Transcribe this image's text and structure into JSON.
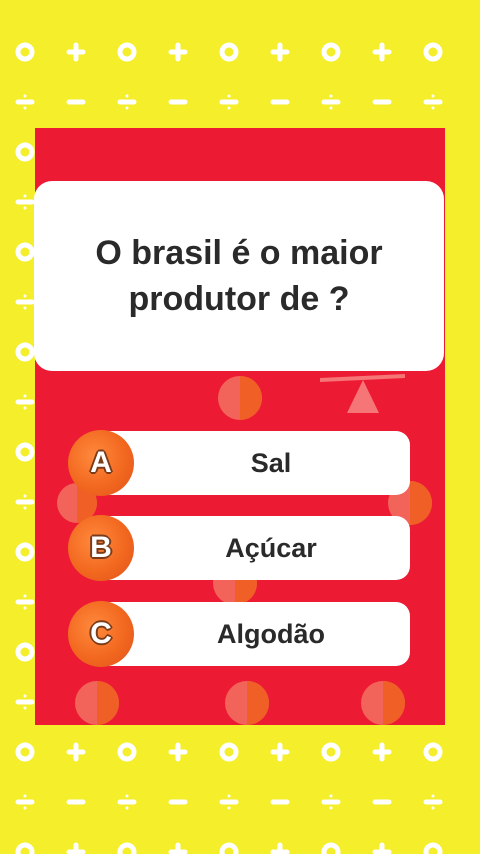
{
  "colors": {
    "background": "#f5ee2a",
    "panel": "#ec1a33",
    "card": "#ffffff",
    "badge": "#f2681f",
    "text": "#2a2a2a"
  },
  "question": {
    "line1": "O brasil é o maior",
    "line2": "produtor de ?"
  },
  "answers": [
    {
      "letter": "A",
      "label": "Sal"
    },
    {
      "letter": "B",
      "label": "Açúcar"
    },
    {
      "letter": "C",
      "label": "Algodão"
    }
  ],
  "background_symbols": [
    "o",
    "+",
    "÷",
    "−"
  ]
}
